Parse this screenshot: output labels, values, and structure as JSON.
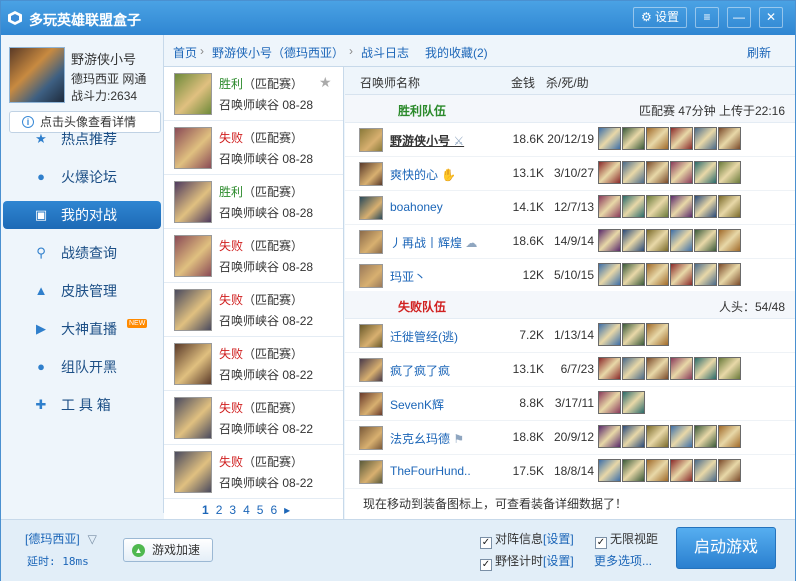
{
  "app": {
    "title": "多玩英雄联盟盒子",
    "settings_label": "设置"
  },
  "profile": {
    "name": "野游侠小号",
    "server": "德玛西亚",
    "network": "网通",
    "power_label": "战斗力:",
    "power": "2634",
    "detail_btn": "点击头像查看详情"
  },
  "nav": [
    {
      "label": "热点推荐",
      "icon": "star-icon"
    },
    {
      "label": "火爆论坛",
      "icon": "chat-bubble-icon"
    },
    {
      "label": "我的对战",
      "icon": "battle-icon",
      "active": true
    },
    {
      "label": "战绩查询",
      "icon": "search-icon"
    },
    {
      "label": "皮肤管理",
      "icon": "wizard-hat-icon"
    },
    {
      "label": "大神直播",
      "icon": "play-icon",
      "badge": "NEW"
    },
    {
      "label": "组队开黑",
      "icon": "group-icon"
    },
    {
      "label": "工 具 箱",
      "icon": "wrench-icon"
    }
  ],
  "breadcrumb": {
    "home": "首页",
    "player": "野游侠小号（德玛西亚）",
    "log": "战斗日志",
    "favorites": "我的收藏(2)",
    "refresh": "刷新",
    "sep": "›"
  },
  "games": [
    {
      "result": "胜利",
      "mode": "（匹配赛）",
      "map": "召唤师峡谷",
      "date": "08-28",
      "win": true,
      "color": "#6e8a3a"
    },
    {
      "result": "失败",
      "mode": "（匹配赛）",
      "map": "召唤师峡谷",
      "date": "08-28",
      "win": false,
      "color": "#8a4a56"
    },
    {
      "result": "胜利",
      "mode": "（匹配赛）",
      "map": "召唤师峡谷",
      "date": "08-28",
      "win": true,
      "color": "#4e3a5e"
    },
    {
      "result": "失败",
      "mode": "（匹配赛）",
      "map": "召唤师峡谷",
      "date": "08-28",
      "win": false,
      "color": "#8a4a56"
    },
    {
      "result": "失败",
      "mode": "（匹配赛）",
      "map": "召唤师峡谷",
      "date": "08-22",
      "win": false,
      "color": "#4a4a5e"
    },
    {
      "result": "失败",
      "mode": "（匹配赛）",
      "map": "召唤师峡谷",
      "date": "08-22",
      "win": false,
      "color": "#5a3a2a"
    },
    {
      "result": "失败",
      "mode": "（匹配赛）",
      "map": "召唤师峡谷",
      "date": "08-22",
      "win": false,
      "color": "#4a4a5e"
    },
    {
      "result": "失败",
      "mode": "（匹配赛）",
      "map": "召唤师峡谷",
      "date": "08-22",
      "win": false,
      "color": "#4a4a5e"
    }
  ],
  "pager": {
    "pages": [
      "1",
      "2",
      "3",
      "4",
      "5",
      "6"
    ],
    "next": "▸"
  },
  "columns": {
    "name": "召唤师名称",
    "gold": "金钱",
    "kda": "杀/死/助"
  },
  "win_team": {
    "label": "胜利队伍",
    "info": "匹配赛 47分钟 上传于22:16"
  },
  "loss_team": {
    "label": "失败队伍",
    "info": "人头：54/48"
  },
  "win_players": [
    {
      "name": "野游侠小号",
      "gold": "18.6K",
      "kda": "20/12/19",
      "me": true,
      "tag": "sword-icon",
      "color": "#8a7a3a"
    },
    {
      "name": "爽快的心",
      "gold": "13.1K",
      "kda": "3/10/27",
      "tag": "hand-icon",
      "color": "#5a3a2a"
    },
    {
      "name": "boahoney",
      "gold": "14.1K",
      "kda": "12/7/13",
      "color": "#2a4a5a"
    },
    {
      "name": "丿再战丨辉煌",
      "gold": "18.6K",
      "kda": "14/9/14",
      "tag": "cloud-icon",
      "color": "#8a6a4a"
    },
    {
      "name": "玛亚丶",
      "gold": "12K",
      "kda": "5/10/15",
      "color": "#9a7a5a"
    }
  ],
  "loss_players": [
    {
      "name": "迁徙管经(逃)",
      "gold": "7.2K",
      "kda": "1/13/14",
      "color": "#6a5a2a"
    },
    {
      "name": "疯了疯了疯",
      "gold": "13.1K",
      "kda": "6/7/23",
      "color": "#4a3a4a"
    },
    {
      "name": "SevenK辉",
      "gold": "8.8K",
      "kda": "3/17/11",
      "color": "#6a3a2a"
    },
    {
      "name": "法克幺玛德",
      "gold": "18.8K",
      "kda": "20/9/12",
      "tag": "badge-icon",
      "color": "#7a5a3a"
    },
    {
      "name": "TheFourHund..",
      "gold": "17.5K",
      "kda": "18/8/14",
      "color": "#5a5a3a"
    }
  ],
  "item_colors": [
    "#3d6fa8",
    "#7a4a2a",
    "#2a4a7a",
    "#8a2a2a",
    "#6a7a3a",
    "#3a5a3a",
    "#8a3a5a",
    "#7a6a2a",
    "#4a6a8a",
    "#5a2a6a",
    "#a06a2a",
    "#2a6a6a"
  ],
  "hint": "现在移动到装备图标上，可查看装备详细数据了！",
  "bottom": {
    "region": "[德玛西亚]",
    "latency_label": "延时:",
    "latency": "18ms",
    "accel": "游戏加速",
    "opt1": "对阵信息",
    "opt2": "无限视距",
    "opt3": "野怪计时",
    "opt4": "更多选项...",
    "set": "[设置]",
    "start": "启动游戏"
  }
}
